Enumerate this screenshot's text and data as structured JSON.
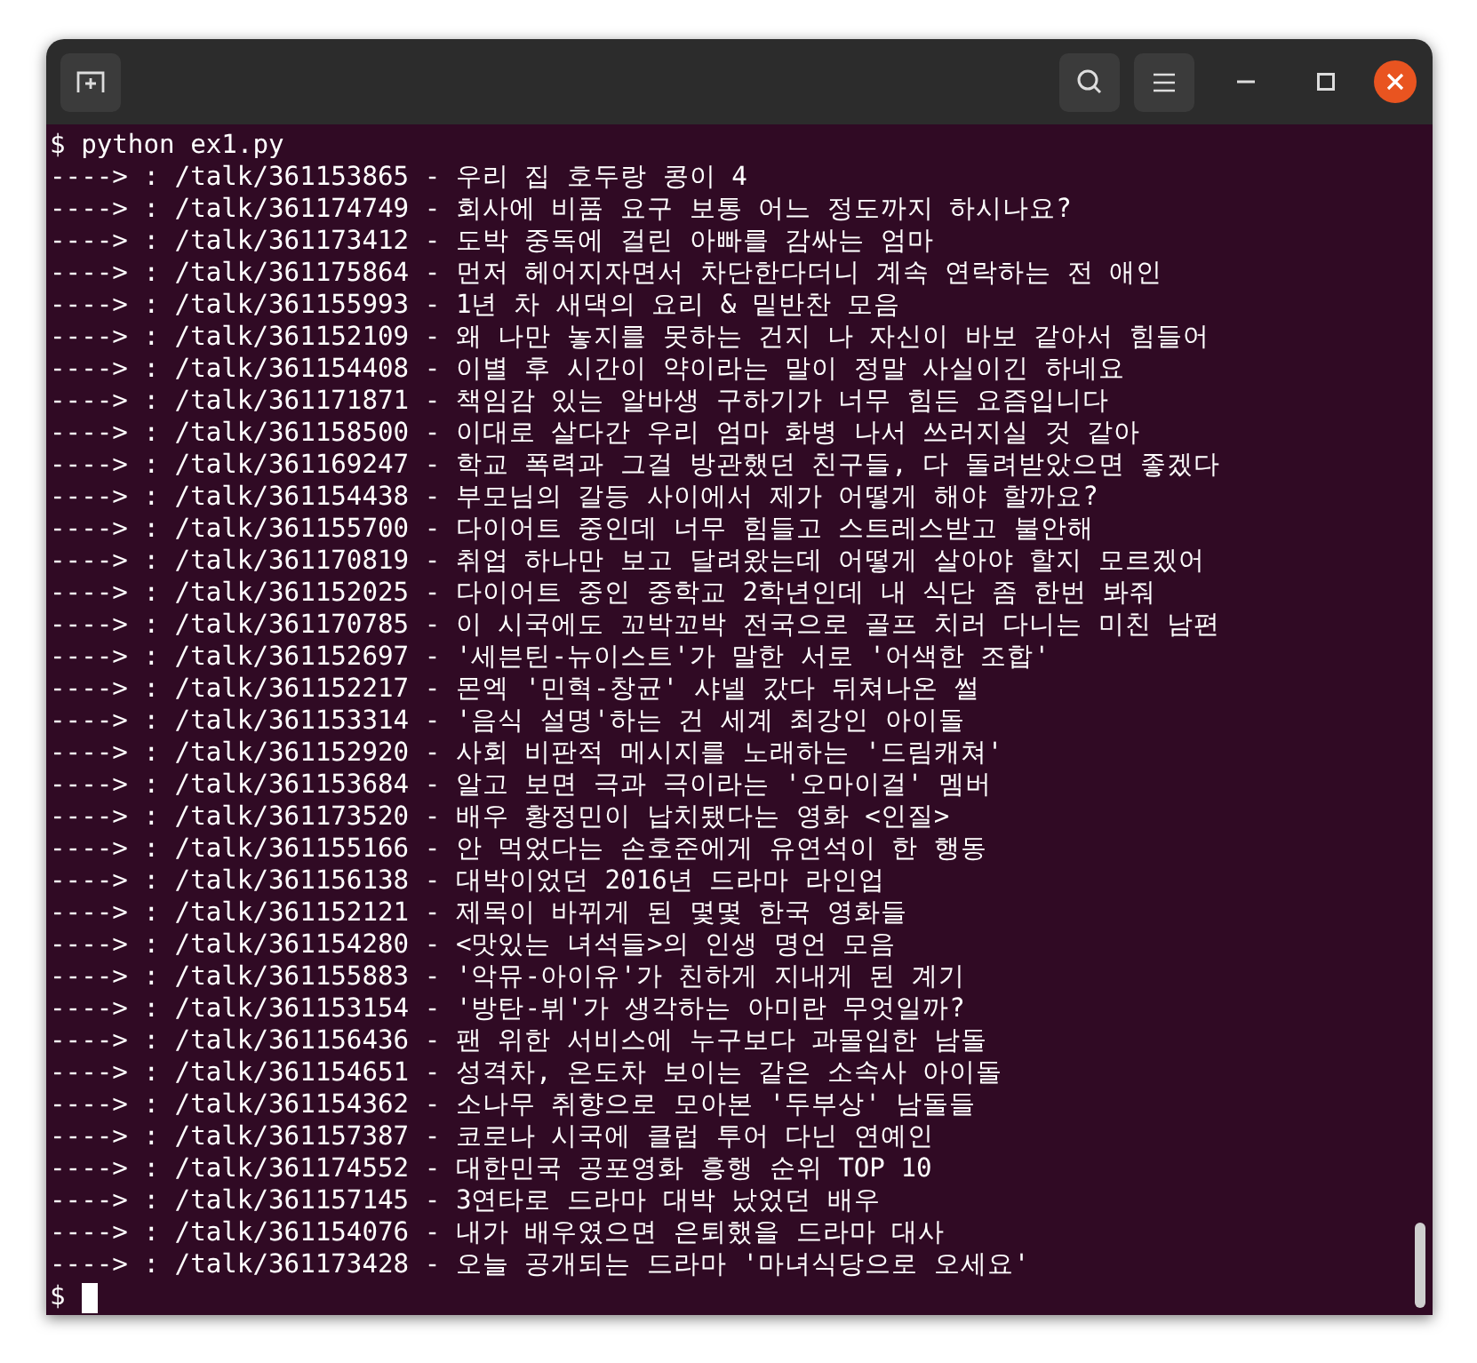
{
  "terminal": {
    "lines": [
      "$ python ex1.py",
      "----> : /talk/361153865 - 우리 집 호두랑 콩이 4",
      "----> : /talk/361174749 - 회사에 비품 요구 보통 어느 정도까지 하시나요?",
      "----> : /talk/361173412 - 도박 중독에 걸린 아빠를 감싸는 엄마",
      "----> : /talk/361175864 - 먼저 헤어지자면서 차단한다더니 계속 연락하는 전 애인",
      "----> : /talk/361155993 - 1년 차 새댁의 요리 & 밑반찬 모음",
      "----> : /talk/361152109 - 왜 나만 놓지를 못하는 건지 나 자신이 바보 같아서 힘들어",
      "----> : /talk/361154408 - 이별 후 시간이 약이라는 말이 정말 사실이긴 하네요",
      "----> : /talk/361171871 - 책임감 있는 알바생 구하기가 너무 힘든 요즘입니다",
      "----> : /talk/361158500 - 이대로 살다간 우리 엄마 화병 나서 쓰러지실 것 같아",
      "----> : /talk/361169247 - 학교 폭력과 그걸 방관했던 친구들, 다 돌려받았으면 좋겠다",
      "----> : /talk/361154438 - 부모님의 갈등 사이에서 제가 어떻게 해야 할까요?",
      "----> : /talk/361155700 - 다이어트 중인데 너무 힘들고 스트레스받고 불안해",
      "----> : /talk/361170819 - 취업 하나만 보고 달려왔는데 어떻게 살아야 할지 모르겠어",
      "----> : /talk/361152025 - 다이어트 중인 중학교 2학년인데 내 식단 좀 한번 봐줘",
      "----> : /talk/361170785 - 이 시국에도 꼬박꼬박 전국으로 골프 치러 다니는 미친 남편",
      "----> : /talk/361152697 - '세븐틴-뉴이스트'가 말한 서로 '어색한 조합'",
      "----> : /talk/361152217 - 몬엑 '민혁-창균' 샤넬 갔다 뒤쳐나온 썰",
      "----> : /talk/361153314 - '음식 설명'하는 건 세계 최강인 아이돌",
      "----> : /talk/361152920 - 사회 비판적 메시지를 노래하는 '드림캐쳐'",
      "----> : /talk/361153684 - 알고 보면 극과 극이라는 '오마이걸' 멤버",
      "----> : /talk/361173520 - 배우 황정민이 납치됐다는 영화 <인질>",
      "----> : /talk/361155166 - 안 먹었다는 손호준에게 유연석이 한 행동",
      "----> : /talk/361156138 - 대박이었던 2016년 드라마 라인업",
      "----> : /talk/361152121 - 제목이 바뀌게 된 몇몇 한국 영화들",
      "----> : /talk/361154280 - <맛있는 녀석들>의 인생 명언 모음",
      "----> : /talk/361155883 - '악뮤-아이유'가 친하게 지내게 된 계기",
      "----> : /talk/361153154 - '방탄-뷔'가 생각하는 아미란 무엇일까?",
      "----> : /talk/361156436 - 팬 위한 서비스에 누구보다 과몰입한 남돌",
      "----> : /talk/361154651 - 성격차, 온도차 보이는 같은 소속사 아이돌",
      "----> : /talk/361154362 - 소나무 취향으로 모아본 '두부상' 남돌들",
      "----> : /talk/361157387 - 코로나 시국에 클럽 투어 다닌 연예인",
      "----> : /talk/361174552 - 대한민국 공포영화 흥행 순위 TOP 10",
      "----> : /talk/361157145 - 3연타로 드라마 대박 났었던 배우",
      "----> : /talk/361154076 - 내가 배우였으면 은퇴했을 드라마 대사",
      "----> : /talk/361173428 - 오늘 공개되는 드라마 '마녀식당으로 오세요'"
    ],
    "prompt": "$"
  }
}
